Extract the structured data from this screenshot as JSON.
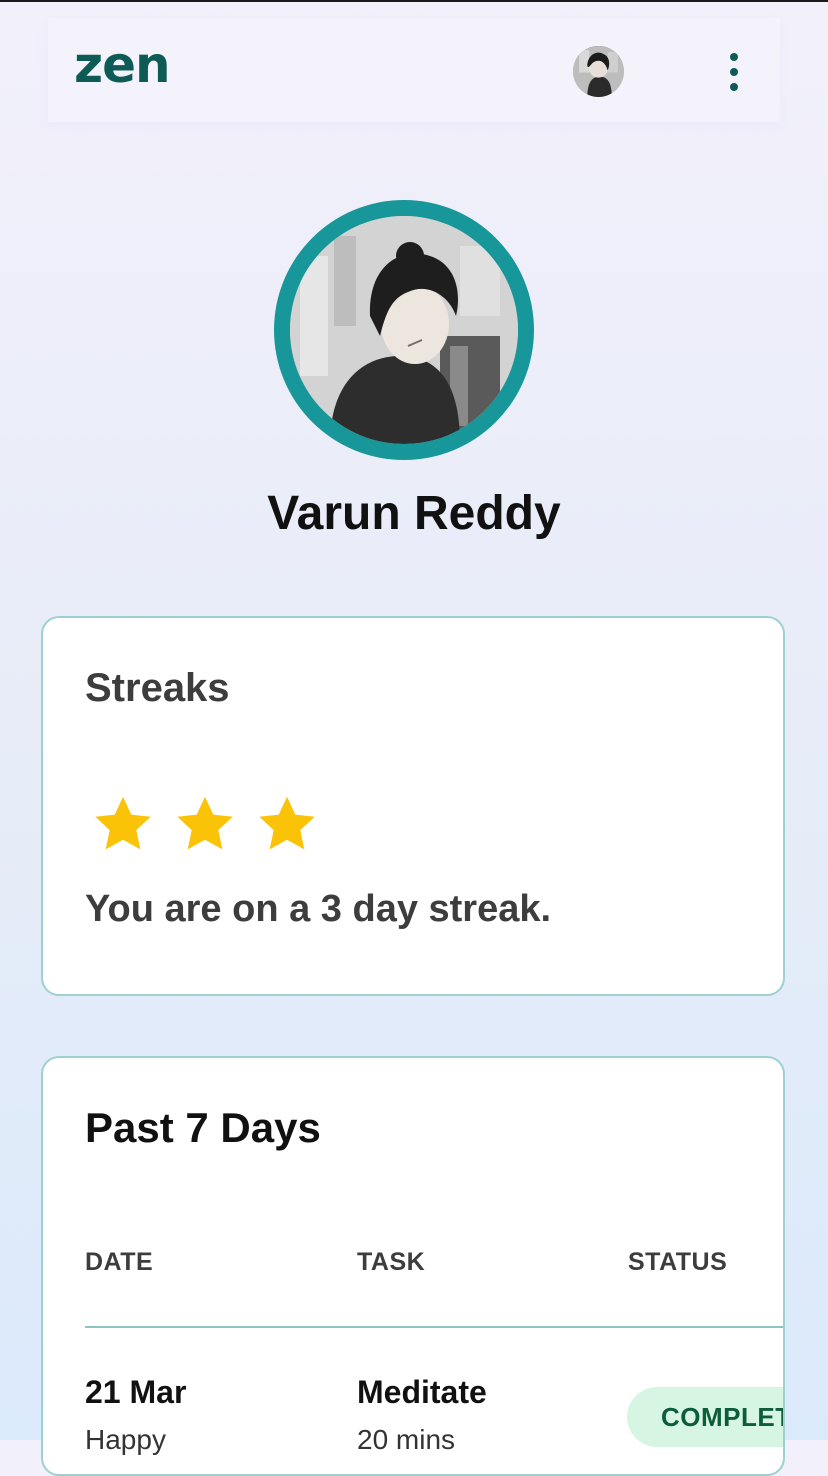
{
  "header": {
    "logo": "zen"
  },
  "profile": {
    "name": "Varun Reddy"
  },
  "streaks": {
    "title": "Streaks",
    "stars": 3,
    "message": "You are on a 3 day streak."
  },
  "history": {
    "title": "Past 7 Days",
    "columns": [
      "DATE",
      "TASK",
      "STATUS"
    ],
    "rows": [
      {
        "date": "21 Mar",
        "mood": "Happy",
        "task": "Meditate",
        "duration": "20 mins",
        "status": "COMPLETED"
      }
    ]
  },
  "colors": {
    "brand": "#0e5b56",
    "avatar_ring": "#17979a",
    "star": "#fbc308",
    "card_border": "#9fd0d0",
    "status_bg": "#d7f5e3",
    "status_text": "#0c5d3b"
  }
}
